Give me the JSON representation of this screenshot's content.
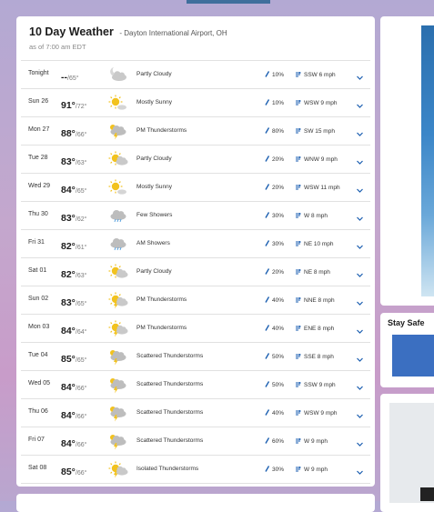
{
  "header": {
    "title": "10 Day Weather",
    "location": "- Dayton International Airport, OH",
    "as_of": "as of 7:00 am EDT"
  },
  "rows": [
    {
      "day": "Tonight",
      "hi": "--",
      "lo": "/65°",
      "icon": "partly-cloudy-night-icon",
      "cond": "Partly Cloudy",
      "precip": "10%",
      "wind": "SSW 6 mph"
    },
    {
      "day": "Sun 26",
      "hi": "91°",
      "lo": "/72°",
      "icon": "mostly-sunny-icon",
      "cond": "Mostly Sunny",
      "precip": "10%",
      "wind": "WSW 9 mph"
    },
    {
      "day": "Mon 27",
      "hi": "88°",
      "lo": "/66°",
      "icon": "thunderstorm-icon",
      "cond": "PM Thunderstorms",
      "precip": "80%",
      "wind": "SW 15 mph"
    },
    {
      "day": "Tue 28",
      "hi": "83°",
      "lo": "/63°",
      "icon": "partly-cloudy-icon",
      "cond": "Partly Cloudy",
      "precip": "20%",
      "wind": "WNW 9 mph"
    },
    {
      "day": "Wed 29",
      "hi": "84°",
      "lo": "/65°",
      "icon": "mostly-sunny-icon",
      "cond": "Mostly Sunny",
      "precip": "20%",
      "wind": "WSW 11 mph"
    },
    {
      "day": "Thu 30",
      "hi": "83°",
      "lo": "/62°",
      "icon": "showers-icon",
      "cond": "Few Showers",
      "precip": "30%",
      "wind": "W 8 mph"
    },
    {
      "day": "Fri 31",
      "hi": "82°",
      "lo": "/61°",
      "icon": "showers-icon",
      "cond": "AM Showers",
      "precip": "30%",
      "wind": "NE 10 mph"
    },
    {
      "day": "Sat 01",
      "hi": "82°",
      "lo": "/63°",
      "icon": "partly-cloudy-icon",
      "cond": "Partly Cloudy",
      "precip": "20%",
      "wind": "NE 8 mph"
    },
    {
      "day": "Sun 02",
      "hi": "83°",
      "lo": "/65°",
      "icon": "sun-thunder-icon",
      "cond": "PM Thunderstorms",
      "precip": "40%",
      "wind": "NNE 8 mph"
    },
    {
      "day": "Mon 03",
      "hi": "84°",
      "lo": "/64°",
      "icon": "sun-thunder-icon",
      "cond": "PM Thunderstorms",
      "precip": "40%",
      "wind": "ENE 8 mph"
    },
    {
      "day": "Tue 04",
      "hi": "85°",
      "lo": "/65°",
      "icon": "thunderstorm-icon",
      "cond": "Scattered Thunderstorms",
      "precip": "50%",
      "wind": "SSE 8 mph"
    },
    {
      "day": "Wed 05",
      "hi": "84°",
      "lo": "/66°",
      "icon": "thunderstorm-icon",
      "cond": "Scattered Thunderstorms",
      "precip": "50%",
      "wind": "SSW 9 mph"
    },
    {
      "day": "Thu 06",
      "hi": "84°",
      "lo": "/66°",
      "icon": "thunderstorm-icon",
      "cond": "Scattered Thunderstorms",
      "precip": "40%",
      "wind": "WSW 9 mph"
    },
    {
      "day": "Fri 07",
      "hi": "84°",
      "lo": "/66°",
      "icon": "thunderstorm-icon",
      "cond": "Scattered Thunderstorms",
      "precip": "60%",
      "wind": "W 9 mph"
    },
    {
      "day": "Sat 08",
      "hi": "85°",
      "lo": "/66°",
      "icon": "sun-thunder-icon",
      "cond": "Isolated Thunderstorms",
      "precip": "30%",
      "wind": "W 9 mph"
    }
  ],
  "sidebar": {
    "stay_safe": "Stay Safe"
  },
  "colors": {
    "accent_blue": "#1a5eb0",
    "sun_yellow": "#f2c21e",
    "cloud_gray": "#c9c9c9"
  }
}
